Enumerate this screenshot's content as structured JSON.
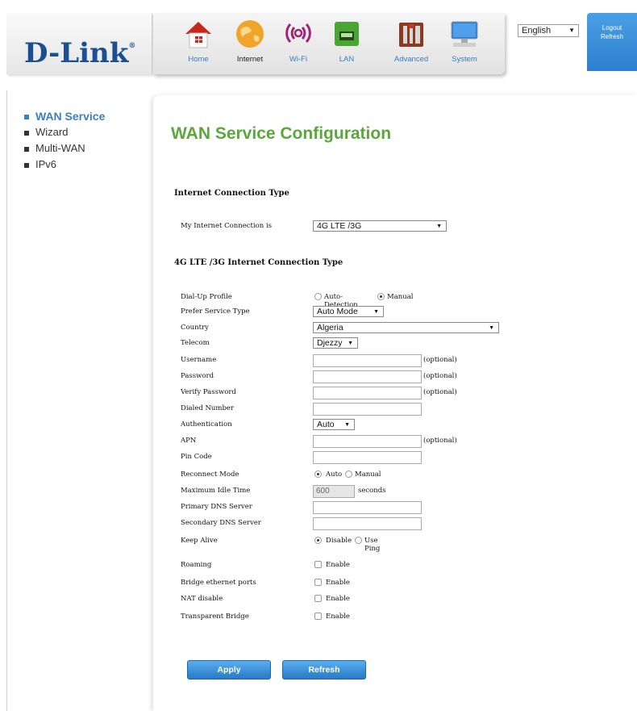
{
  "brand": {
    "logo_text": "D-Link",
    "logo_mark": "®",
    "color": "#1b4f93"
  },
  "nav": {
    "items": [
      {
        "label": "Home",
        "icon": "home-icon"
      },
      {
        "label": "Internet",
        "icon": "globe-icon"
      },
      {
        "label": "Wi-Fi",
        "icon": "wifi-icon"
      },
      {
        "label": "LAN",
        "icon": "lan-port-icon"
      },
      {
        "label": "Advanced",
        "icon": "tools-icon"
      },
      {
        "label": "System",
        "icon": "computer-icon"
      }
    ],
    "active": "Internet"
  },
  "language": {
    "selected": "English"
  },
  "account": {
    "logout_label": "Logout",
    "refresh_label": "Refresh"
  },
  "sidebar": {
    "items": [
      {
        "label": "WAN Service"
      },
      {
        "label": "Wizard"
      },
      {
        "label": "Multi-WAN"
      },
      {
        "label": "IPv6"
      }
    ]
  },
  "main": {
    "title": "WAN Service Configuration",
    "section1_title": "Internet Connection Type",
    "connection_label": "My Internet Connection is",
    "connection_value": "4G LTE /3G",
    "section2_title": "4G LTE /3G Internet Connection Type",
    "fields": {
      "dialup_profile": {
        "label": "Dial-Up Profile",
        "opt1": "Auto-Detection",
        "opt2": "Manual",
        "selected": "Manual"
      },
      "prefer_service": {
        "label": "Prefer Service Type",
        "value": "Auto Mode"
      },
      "country": {
        "label": "Country",
        "value": "Algeria"
      },
      "telecom": {
        "label": "Telecom",
        "value": "Djezzy"
      },
      "username": {
        "label": "Username",
        "value": "",
        "hint": "(optional)"
      },
      "password": {
        "label": "Password",
        "value": "",
        "hint": "(optional)"
      },
      "verify_password": {
        "label": "Verify Password",
        "value": "",
        "hint": "(optional)"
      },
      "dialed_number": {
        "label": "Dialed Number",
        "value": ""
      },
      "authentication": {
        "label": "Authentication",
        "value": "Auto"
      },
      "apn": {
        "label": "APN",
        "value": "",
        "hint": "(optional)"
      },
      "pin_code": {
        "label": "Pin Code",
        "value": ""
      },
      "reconnect_mode": {
        "label": "Reconnect Mode",
        "opt1": "Auto",
        "opt2": "Manual",
        "selected": "Auto"
      },
      "max_idle": {
        "label": "Maximum Idle Time",
        "value": "600",
        "unit": "seconds"
      },
      "primary_dns": {
        "label": "Primary DNS Server",
        "value": ""
      },
      "secondary_dns": {
        "label": "Secondary DNS Server",
        "value": ""
      },
      "keep_alive": {
        "label": "Keep Alive",
        "opt1": "Disable",
        "opt2": "Use Ping",
        "selected": "Disable"
      },
      "roaming": {
        "label": "Roaming",
        "opt": "Enable",
        "checked": false
      },
      "bridge_ports": {
        "label": "Bridge ethernet ports",
        "opt": "Enable",
        "checked": false
      },
      "nat_disable": {
        "label": "NAT disable",
        "opt": "Enable",
        "checked": false
      },
      "transparent_bridge": {
        "label": "Transparent Bridge",
        "opt": "Enable",
        "checked": false
      }
    },
    "apply_label": "Apply",
    "refresh_label": "Refresh"
  },
  "colors": {
    "accent_blue": "#3a7fc0",
    "title_green": "#5aa83a",
    "button_blue": "#2c7fcc"
  }
}
